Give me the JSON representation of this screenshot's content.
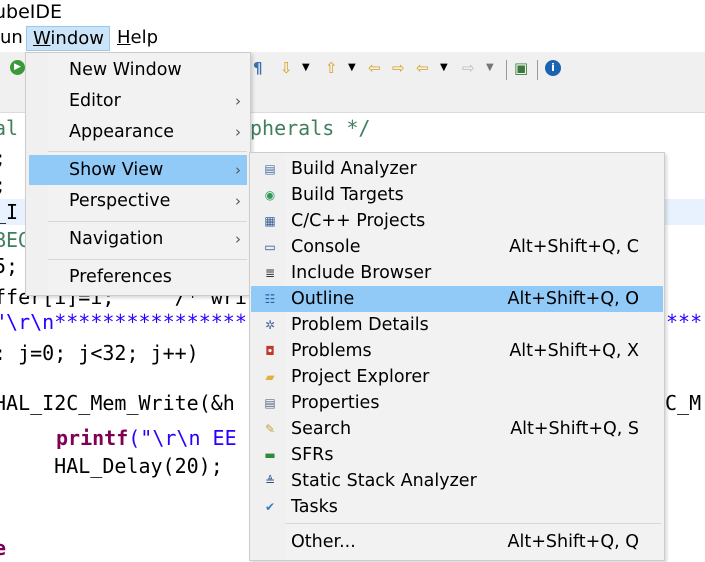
{
  "window_title": "ubeIDE",
  "menubar": [
    {
      "label": "un"
    },
    {
      "label": "Window",
      "mnemonic": "W",
      "rest": "indow"
    },
    {
      "label": "Help",
      "mnemonic": "H",
      "rest": "elp"
    }
  ],
  "code_lines": [
    {
      "left": "al",
      "right": "pherals */"
    },
    {
      "left": ";"
    },
    {
      "left": ";"
    },
    {
      "left": "_I"
    },
    {
      "left": "BEG"
    },
    {
      "left": "5;"
    },
    {
      "left": "ffer[i]=i;     /* wri"
    },
    {
      "left": "\"\\r\\n****************",
      "right": "***"
    },
    {
      "left": ": j=0; j<32; j++)"
    },
    {
      "left": "HAL_I2C_Mem_Write(&h",
      "right": "C_M"
    },
    {
      "kw": "printf",
      "left": "(\"\\r\\n EE"
    },
    {
      "left": "    HAL_Delay(20);"
    },
    {
      "left": "e"
    }
  ],
  "window_menu": {
    "items": [
      {
        "label": "New Window"
      },
      {
        "label": "Editor",
        "submenu": true
      },
      {
        "label": "Appearance",
        "submenu": true
      },
      {
        "label": "Show View",
        "submenu": true,
        "highlighted": true
      },
      {
        "label": "Perspective",
        "submenu": true
      },
      {
        "label": "Navigation",
        "submenu": true
      },
      {
        "label": "Preferences"
      }
    ]
  },
  "show_view_menu": {
    "items": [
      {
        "label": "Build Analyzer",
        "icon": "build-analyzer-icon",
        "shortcut": ""
      },
      {
        "label": "Build Targets",
        "icon": "build-targets-icon",
        "shortcut": ""
      },
      {
        "label": "C/C++ Projects",
        "icon": "cpp-projects-icon",
        "shortcut": ""
      },
      {
        "label": "Console",
        "icon": "console-icon",
        "shortcut": "Alt+Shift+Q, C"
      },
      {
        "label": "Include Browser",
        "icon": "include-browser-icon",
        "shortcut": ""
      },
      {
        "label": "Outline",
        "icon": "outline-icon",
        "shortcut": "Alt+Shift+Q, O",
        "highlighted": true
      },
      {
        "label": "Problem Details",
        "icon": "problem-details-icon",
        "shortcut": ""
      },
      {
        "label": "Problems",
        "icon": "problems-icon",
        "shortcut": "Alt+Shift+Q, X"
      },
      {
        "label": "Project Explorer",
        "icon": "project-explorer-icon",
        "shortcut": ""
      },
      {
        "label": "Properties",
        "icon": "properties-icon",
        "shortcut": ""
      },
      {
        "label": "Search",
        "icon": "search-icon",
        "shortcut": "Alt+Shift+Q, S"
      },
      {
        "label": "SFRs",
        "icon": "sfrs-icon",
        "shortcut": ""
      },
      {
        "label": "Static Stack Analyzer",
        "icon": "static-stack-analyzer-icon",
        "shortcut": ""
      },
      {
        "label": "Tasks",
        "icon": "tasks-icon",
        "shortcut": ""
      }
    ],
    "other": {
      "label": "Other...",
      "shortcut": "Alt+Shift+Q, Q"
    }
  },
  "colors": {
    "highlight": "#91c9f7",
    "menu_bg": "#f2f2f2",
    "current_line": "#e8f2fe",
    "keyword": "#7f0055",
    "string": "#2a00ff",
    "comment": "#3f7f5f"
  }
}
